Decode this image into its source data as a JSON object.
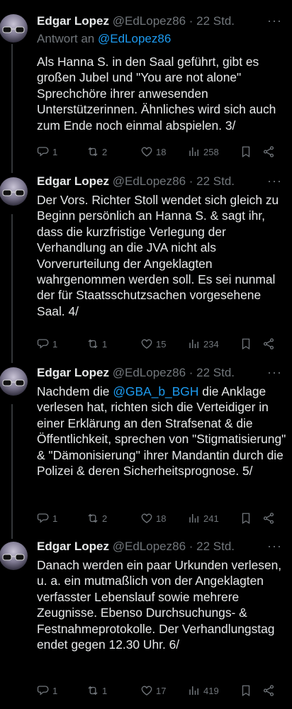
{
  "tweets": [
    {
      "name": "Edgar Lopez",
      "handle": "@EdLopez86",
      "time": "· 22 Std.",
      "reply_prefix": "Antwort an ",
      "reply_handle": "@EdLopez86",
      "text": "Als Hanna S. in den Saal geführt, gibt es großen Jubel und \"You are not alone\" Sprechchöre ihrer anwesenden Unterstützerinnen. Ähnliches wird sich auch zum Ende noch einmal abspielen. 3/",
      "replies": "1",
      "retweets": "2",
      "likes": "18",
      "views": "258"
    },
    {
      "name": "Edgar Lopez",
      "handle": "@EdLopez86",
      "time": "· 22 Std.",
      "text": "Der Vors. Richter Stoll wendet sich gleich zu Beginn persönlich an Hanna S. & sagt ihr, dass die kurzfristige Verlegung der Verhandlung an die JVA nicht als Vorverurteilung der Angeklagten wahrgenommen werden soll. Es sei nunmal der für Staatsschutzsachen vorgesehene Saal. 4/",
      "replies": "1",
      "retweets": "1",
      "likes": "15",
      "views": "234"
    },
    {
      "name": "Edgar Lopez",
      "handle": "@EdLopez86",
      "time": "· 22 Std.",
      "text_pre": "Nachdem die ",
      "text_mention": "@GBA_b_BGH",
      "text_post": " die Anklage verlesen hat, richten sich die Verteidiger in einer Erklärung an den Strafsenat & die Öffentlichkeit, sprechen von \"Stigmatisierung\" & \"Dämonisierung\" ihrer Mandantin durch die Polizei & deren Sicherheitsprognose. 5/",
      "replies": "1",
      "retweets": "2",
      "likes": "18",
      "views": "241"
    },
    {
      "name": "Edgar Lopez",
      "handle": "@EdLopez86",
      "time": "· 22 Std.",
      "text": "Danach werden ein paar Urkunden verlesen, u. a. ein mutmaßlich von der Angeklagten verfasster Lebenslauf sowie mehrere Zeugnisse. Ebenso Durchsuchungs- & Festnahmeprotokolle. Der Verhandlungstag endet gegen 12.30 Uhr. 6/",
      "replies": "1",
      "retweets": "1",
      "likes": "17",
      "views": "419"
    }
  ],
  "icons": {
    "reply": "reply-icon",
    "retweet": "retweet-icon",
    "like": "heart-icon",
    "views": "views-icon",
    "bookmark": "bookmark-icon",
    "share": "share-icon",
    "more": "more-icon"
  },
  "colors": {
    "background": "#000000",
    "text": "#e7e9ea",
    "muted": "#71767b",
    "link": "#1d9bf0",
    "thread_line": "#333639"
  }
}
